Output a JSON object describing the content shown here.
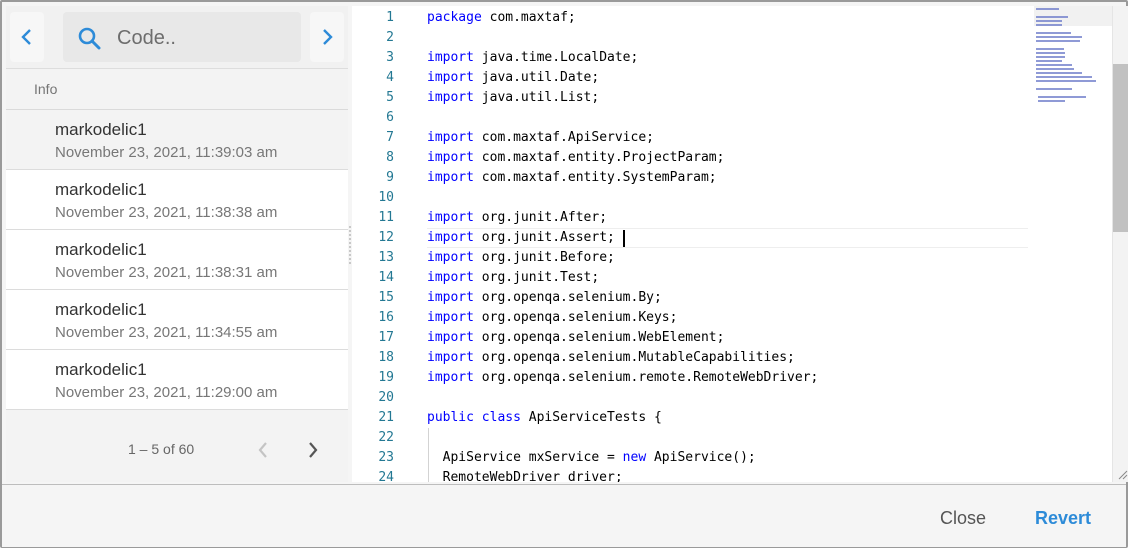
{
  "search": {
    "placeholder": "Code.."
  },
  "list_header": "Info",
  "history": [
    {
      "user": "markodelic1",
      "date": "November 23, 2021, 11:39:03 am",
      "selected": true
    },
    {
      "user": "markodelic1",
      "date": "November 23, 2021, 11:38:38 am",
      "selected": false
    },
    {
      "user": "markodelic1",
      "date": "November 23, 2021, 11:38:31 am",
      "selected": false
    },
    {
      "user": "markodelic1",
      "date": "November 23, 2021, 11:34:55 am",
      "selected": false
    },
    {
      "user": "markodelic1",
      "date": "November 23, 2021, 11:29:00 am",
      "selected": false
    }
  ],
  "pagination": {
    "range": "1 – 5 of 60"
  },
  "editor": {
    "line_numbers": [
      "1",
      "2",
      "3",
      "4",
      "5",
      "6",
      "7",
      "8",
      "9",
      "10",
      "11",
      "12",
      "13",
      "14",
      "15",
      "16",
      "17",
      "18",
      "19",
      "20",
      "21",
      "22",
      "23",
      "24"
    ],
    "lines": [
      "package com.maxtaf;",
      "",
      "import java.time.LocalDate;",
      "import java.util.Date;",
      "import java.util.List;",
      "",
      "import com.maxtaf.ApiService;",
      "import com.maxtaf.entity.ProjectParam;",
      "import com.maxtaf.entity.SystemParam;",
      "",
      "import org.junit.After;",
      "import org.junit.Assert;",
      "import org.junit.Before;",
      "import org.junit.Test;",
      "import org.openqa.selenium.By;",
      "import org.openqa.selenium.Keys;",
      "import org.openqa.selenium.WebElement;",
      "import org.openqa.selenium.MutableCapabilities;",
      "import org.openqa.selenium.remote.RemoteWebDriver;",
      "",
      "public class ApiServiceTests {",
      "",
      "  ApiService mxService = new ApiService();",
      "  RemoteWebDriver driver;"
    ],
    "keyword_color": "#0000ff",
    "line_number_color": "#237893"
  },
  "footer": {
    "close_label": "Close",
    "revert_label": "Revert"
  },
  "accent_color": "#2d8bd8"
}
